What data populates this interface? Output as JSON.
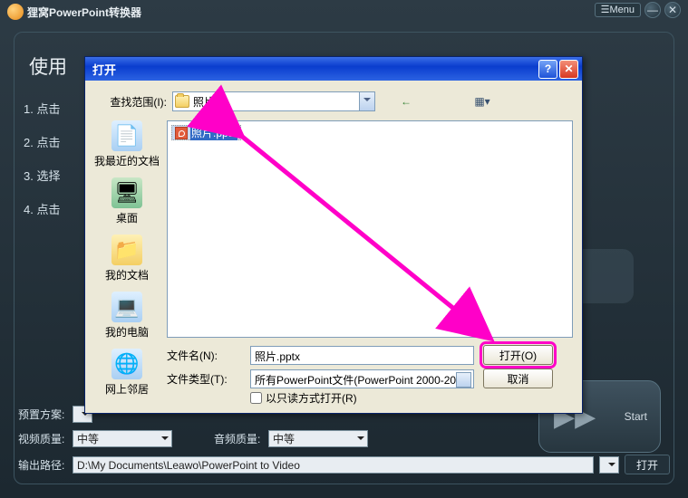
{
  "app": {
    "title": "狸窝PowerPoint转换器",
    "menu_btn": "☰Menu",
    "usage_header": "使用",
    "steps": [
      "1. 点击",
      "2. 点击",
      "3. 选择",
      "4. 点击"
    ],
    "preset_label": "预置方案:",
    "vquality_label": "视频质量:",
    "vquality_value": "中等",
    "aquality_label": "音频质量:",
    "aquality_value": "中等",
    "outpath_label": "输出路径:",
    "outpath_value": "D:\\My Documents\\Leawo\\PowerPoint to Video",
    "open_btn": "打开",
    "start_btn": "Start"
  },
  "dialog": {
    "title": "打开",
    "lookin_label": "查找范围(I):",
    "lookin_value": "照片",
    "places": {
      "recent": "我最近的文档",
      "desktop": "桌面",
      "mydocs": "我的文档",
      "mypc": "我的电脑",
      "network": "网上邻居"
    },
    "selected_file": "照片.pptx",
    "filename_label": "文件名(N):",
    "filename_value": "照片.pptx",
    "filetype_label": "文件类型(T):",
    "filetype_value": "所有PowerPoint文件(PowerPoint 2000-20",
    "readonly_label": "以只读方式打开(R)",
    "open_btn": "打开(O)",
    "cancel_btn": "取消"
  },
  "icons": {
    "help": "?",
    "close": "✕",
    "minimize": "—",
    "window": "□",
    "back": "←",
    "up": "📁",
    "newfolder": "📁*",
    "views": "▦▾"
  }
}
